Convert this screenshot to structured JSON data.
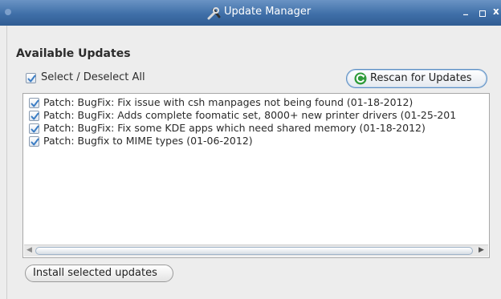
{
  "window": {
    "title": "Update Manager",
    "controls": {
      "minimize": "_",
      "maximize": "□",
      "close": "x"
    }
  },
  "main": {
    "heading": "Available Updates",
    "select_all": {
      "label": "Select / Deselect All",
      "checked": true
    },
    "rescan_button": {
      "label": "Rescan for Updates",
      "icon": "refresh-icon"
    },
    "updates": [
      {
        "label": "Patch: BugFix: Fix issue with csh manpages not being found (01-18-2012)",
        "checked": true
      },
      {
        "label": "Patch: BugFix: Adds complete foomatic set, 8000+ new printer drivers (01-25-201",
        "checked": true
      },
      {
        "label": "Patch: BugFix: Fix some KDE apps which need shared memory (01-18-2012)",
        "checked": true
      },
      {
        "label": "Patch: Bugfix to MIME types (01-06-2012)",
        "checked": true
      }
    ],
    "install_button": {
      "label": "Install selected updates"
    }
  },
  "colors": {
    "titlebar": "#3f6fa8",
    "window_bg": "#ededed",
    "check": "#3b7dc4",
    "rescan_icon": "#2e9b3a"
  }
}
